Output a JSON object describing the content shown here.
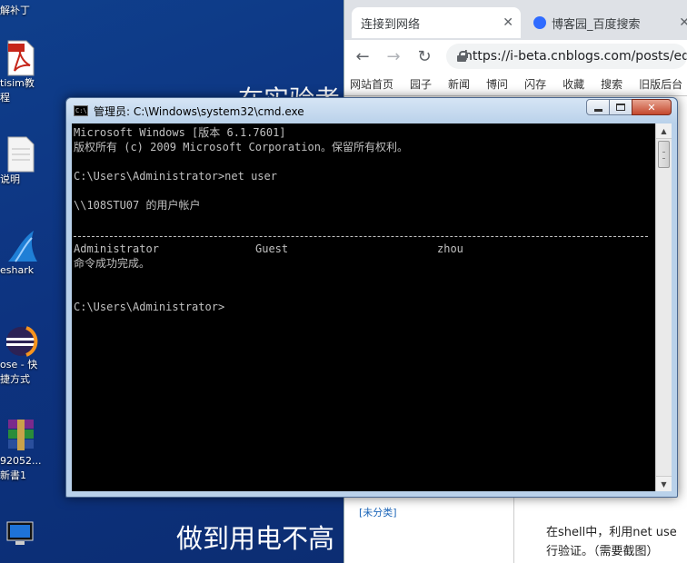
{
  "desktop": {
    "icons": [
      {
        "label": "解补丁"
      },
      {
        "label": "tisim教\n程"
      },
      {
        "label": "说明"
      },
      {
        "label": "eshark"
      },
      {
        "label": "ose - 快\n捷方式"
      },
      {
        "label": "92052...\n新書1"
      }
    ],
    "background_title": "在实验考",
    "background_bottom": "做到用电不高"
  },
  "browser": {
    "tabs": [
      {
        "label": "连接到网络",
        "close": "✕"
      },
      {
        "label": "博客园_百度搜索",
        "close": "✕"
      }
    ],
    "url": "https://i-beta.cnblogs.com/posts/ed",
    "site_nav": [
      "网站首页",
      "园子",
      "新闻",
      "博问",
      "闪存",
      "收藏",
      "搜索",
      "旧版后台"
    ],
    "category_link": "[未分类]",
    "article_line1": "在shell中，利用net use",
    "article_line2": "行验证。（需要截图）"
  },
  "cmd": {
    "title": "管理员: C:\\Windows\\system32\\cmd.exe",
    "icon_text": "C:\\",
    "lines": {
      "l1": "Microsoft Windows [版本 6.1.7601]",
      "l2": "版权所有 (c) 2009 Microsoft Corporation。保留所有权利。",
      "l3": "C:\\Users\\Administrator>net user",
      "l4": "\\\\108STU07 的用户帐户",
      "l6": "命令成功完成。",
      "l7": "C:\\Users\\Administrator>"
    },
    "users": [
      "Administrator",
      "Guest",
      "zhou"
    ]
  }
}
